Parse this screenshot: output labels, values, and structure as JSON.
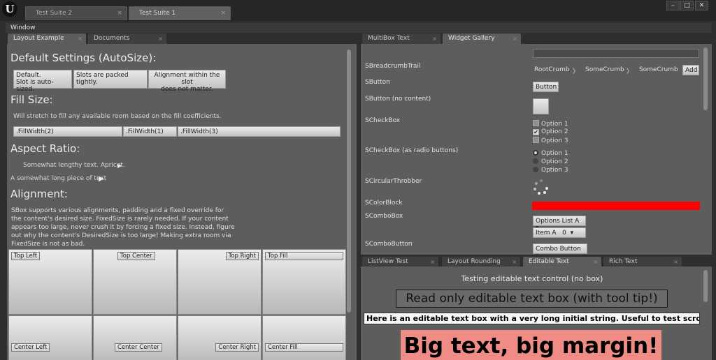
{
  "title_bar": {
    "logo": "U",
    "tabs": [
      {
        "label": "Test Suite 2",
        "close": "×"
      },
      {
        "label": "Test Suite 1",
        "close": "×"
      }
    ],
    "window_buttons": {
      "minimize": "–",
      "maximize": "□",
      "close": "✕"
    }
  },
  "menu": {
    "window": "Window"
  },
  "left_tabs": [
    {
      "label": "Layout Example",
      "close": "×"
    },
    {
      "label": "Documents",
      "close": "×"
    }
  ],
  "layout_example": {
    "default_settings": {
      "title": "Default Settings (AutoSize):",
      "slot1_line1": "Default.",
      "slot1_line2": "Slot is auto-sized.",
      "slot2": "Slots are packed tightly.",
      "slot3_line1": "Alignment within the slot",
      "slot3_line2": "does not matter."
    },
    "fill_size": {
      "title": "Fill Size:",
      "description": "Will stretch to fill any available room based on the fill coefficients.",
      "fill1": ".FillWidth(2)",
      "fill2": ".FillWidth(1)",
      "fill3": ".FillWidth(3)"
    },
    "aspect_ratio": {
      "title": "Aspect Ratio:",
      "text1": "Somewhat lengthy text. Apricot.",
      "text2": "A somewhat long piece of text"
    },
    "alignment": {
      "title": "Alignment:",
      "description": "SBox supports various alignments, padding and a fixed override for the content's desired size. FixedSize is rarely needed. If your content appears too large, never crush it by forcing a fixed size. Instead, figure out why the content's DesiredSize is too large! Making extra room via FixedSize is not as bad.",
      "cells": {
        "top_left": "Top Left",
        "top_center": "Top Center",
        "top_right": "Top Right",
        "top_fill": "Top Fill",
        "center_left": "Center Left",
        "center_center": "Center Center",
        "center_right": "Center Right",
        "center_fill": "Center Fill"
      }
    }
  },
  "right_top_tabs": [
    {
      "label": "MultiBox Text",
      "close": "×"
    },
    {
      "label": "Widget Gallery",
      "close": "×"
    }
  ],
  "widget_gallery": {
    "labels": {
      "breadcrumb": "SBreadcrumbTrail",
      "button": "SButton",
      "button_no_content": "SButton (no content)",
      "checkbox": "SCheckBox",
      "checkbox_radio": "SCheckBox (as radio buttons)",
      "throbber": "SCircularThrobber",
      "colorblock": "SColorBlock",
      "combobox": "SComboBox",
      "combobutton": "SComboButton"
    },
    "breadcrumbs": [
      "RootCrumb",
      "SomeCrumb",
      "SomeCrumb"
    ],
    "crumb_sep": "〉",
    "add_button": "Add",
    "button_label": "Button",
    "checkbox_options": [
      "Option 1",
      "Option 2",
      "Option 3"
    ],
    "checkbox_checked": [
      false,
      true,
      false
    ],
    "checkmark": "✔",
    "radio_options": [
      "Option 1",
      "Option 2",
      "Option 3"
    ],
    "radio_selected": 0,
    "color_block": "#ff0000",
    "combo1": "Options List A",
    "combo2": "Item A   0",
    "combo_arrow": "▾",
    "combo_button": "Combo Button"
  },
  "right_bottom_tabs": [
    {
      "label": "ListView Test",
      "close": "×"
    },
    {
      "label": "Layout Rounding",
      "close": "×"
    },
    {
      "label": "Editable Text",
      "close": "×"
    },
    {
      "label": "Rich Text",
      "close": "×"
    }
  ],
  "editable_text": {
    "heading": "Testing editable text control (no box)",
    "read_only": "Read only editable text box (with tool tip!)",
    "long_box": "Here is an editable text box with a very long initial string.  Useful to test scrolling.",
    "big_text": "Big text, big margin!",
    "big_bg": "#f08c86"
  },
  "colors": {
    "background": "#2e2e2e",
    "panel": "#5d5d5d",
    "color_block": "#ff0000"
  }
}
